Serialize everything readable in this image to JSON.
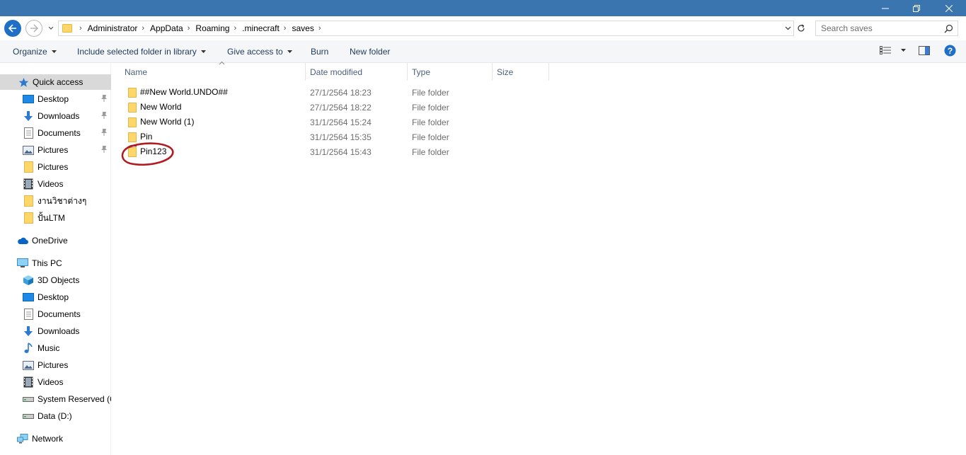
{
  "window": {
    "buttons": [
      "minimize",
      "restore",
      "close"
    ]
  },
  "address": {
    "crumbs": [
      "Administrator",
      "AppData",
      "Roaming",
      ".minecraft",
      "saves"
    ],
    "search_placeholder": "Search saves"
  },
  "toolbar": {
    "organize": "Organize",
    "include_library": "Include selected folder in library",
    "give_access": "Give access to",
    "burn": "Burn",
    "new_folder": "New folder"
  },
  "nav": {
    "quick_access": "Quick access",
    "quick_items": [
      {
        "label": "Desktop",
        "icon": "desktop-icon",
        "pinned": true
      },
      {
        "label": "Downloads",
        "icon": "downloads-icon",
        "pinned": true
      },
      {
        "label": "Documents",
        "icon": "documents-icon",
        "pinned": true
      },
      {
        "label": "Pictures",
        "icon": "pictures-icon",
        "pinned": true
      },
      {
        "label": "Pictures",
        "icon": "folder-icon",
        "pinned": false
      },
      {
        "label": "Videos",
        "icon": "videos-icon",
        "pinned": false
      },
      {
        "label": "งานวิชาต่างๆ",
        "icon": "folder-icon",
        "pinned": false
      },
      {
        "label": "ปั้นLTM",
        "icon": "folder-icon",
        "pinned": false
      }
    ],
    "onedrive": "OneDrive",
    "this_pc": "This PC",
    "pc_items": [
      {
        "label": "3D Objects",
        "icon": "3d-objects-icon"
      },
      {
        "label": "Desktop",
        "icon": "desktop-icon"
      },
      {
        "label": "Documents",
        "icon": "documents-icon"
      },
      {
        "label": "Downloads",
        "icon": "downloads-icon"
      },
      {
        "label": "Music",
        "icon": "music-icon"
      },
      {
        "label": "Pictures",
        "icon": "pictures-icon"
      },
      {
        "label": "Videos",
        "icon": "videos-icon"
      },
      {
        "label": "System Reserved (C",
        "icon": "drive-icon"
      },
      {
        "label": "Data (D:)",
        "icon": "drive-icon"
      }
    ],
    "network": "Network"
  },
  "columns": {
    "name": "Name",
    "date": "Date modified",
    "type": "Type",
    "size": "Size"
  },
  "files": [
    {
      "name": "##New World.UNDO##",
      "date": "27/1/2564 18:23",
      "type": "File folder"
    },
    {
      "name": "New World",
      "date": "27/1/2564 18:22",
      "type": "File folder"
    },
    {
      "name": "New World (1)",
      "date": "31/1/2564 15:24",
      "type": "File folder"
    },
    {
      "name": "Pin",
      "date": "31/1/2564 15:35",
      "type": "File folder"
    },
    {
      "name": "Pin123",
      "date": "31/1/2564 15:43",
      "type": "File folder"
    }
  ],
  "colors": {
    "titlebar": "#3b75b0",
    "folder": "#ffd669",
    "annotation": "#b01c22",
    "selected": "#d9d9d9"
  }
}
